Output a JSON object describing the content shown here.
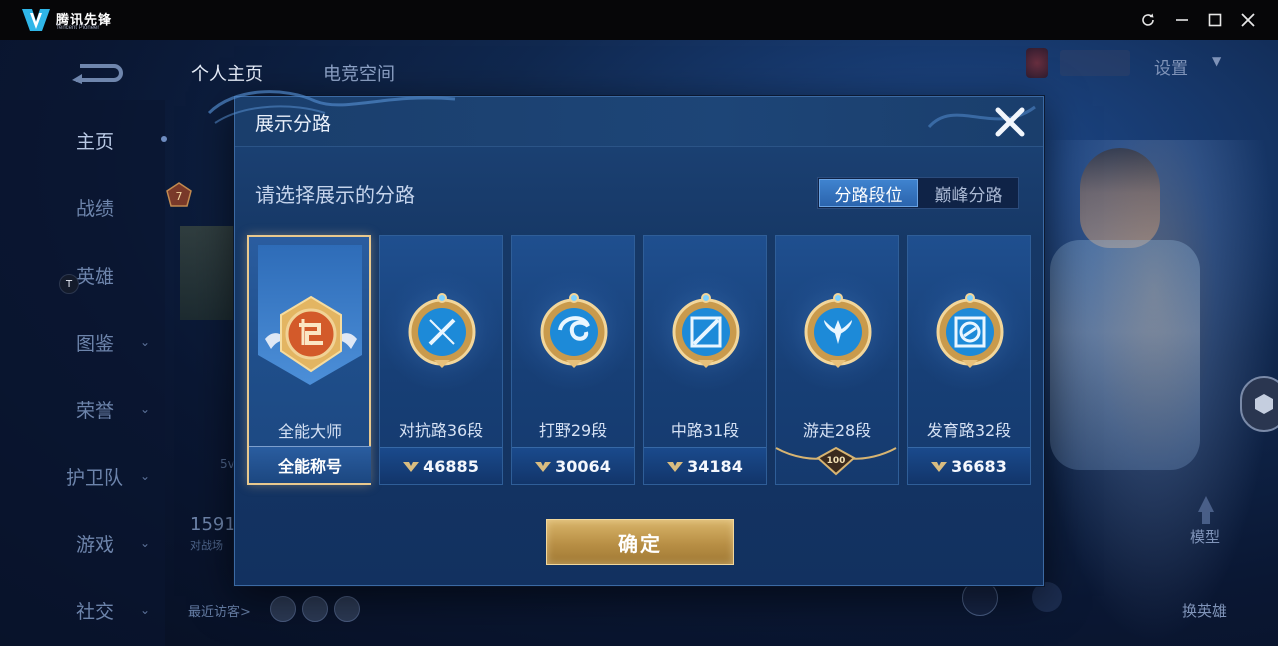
{
  "window": {
    "app_name": "腾讯先锋",
    "app_subtitle": "Tencent Pioneer"
  },
  "background": {
    "tabs": [
      "个人主页",
      "电竞空间"
    ],
    "sidebar_items": [
      {
        "label": "主页",
        "chevron": false
      },
      {
        "label": "战绩",
        "chevron": false
      },
      {
        "label": "英雄",
        "chevron": false
      },
      {
        "label": "图鉴",
        "chevron": true
      },
      {
        "label": "荣誉",
        "chevron": true
      },
      {
        "label": "护卫队",
        "chevron": true
      },
      {
        "label": "游戏",
        "chevron": true
      },
      {
        "label": "社交",
        "chevron": true
      }
    ],
    "settings_label": "设置",
    "level_badge": "7",
    "stat_number": "1591",
    "stat_sub": "对战场",
    "stat_5v": "5v",
    "recent_visitors_label": "最近访客>",
    "model_label": "模型",
    "swap_hero_label": "换英雄",
    "t_badge": "T"
  },
  "modal": {
    "title": "展示分路",
    "prompt": "请选择展示的分路",
    "toggle": [
      {
        "label": "分路段位",
        "active": true
      },
      {
        "label": "巅峰分路",
        "active": false
      }
    ],
    "cards": [
      {
        "name": "全能大师",
        "footer": "全能称号",
        "score": "",
        "selected": true,
        "emblem": "all-round-master-emblem"
      },
      {
        "name": "对抗路36段",
        "footer": "",
        "score": "46885",
        "selected": false,
        "emblem": "clash-lane-emblem"
      },
      {
        "name": "打野29段",
        "footer": "",
        "score": "30064",
        "selected": false,
        "emblem": "jungle-emblem"
      },
      {
        "name": "中路31段",
        "footer": "",
        "score": "34184",
        "selected": false,
        "emblem": "mid-lane-emblem"
      },
      {
        "name": "游走28段",
        "footer": "100",
        "score": "",
        "selected": false,
        "emblem": "roam-emblem"
      },
      {
        "name": "发育路32段",
        "footer": "",
        "score": "36683",
        "selected": false,
        "emblem": "farm-lane-emblem"
      }
    ],
    "confirm_label": "确定"
  },
  "colors": {
    "accent_gold": "#e9c98e",
    "toggle_active": "#3f83cf",
    "modal_bg": "#163866"
  }
}
